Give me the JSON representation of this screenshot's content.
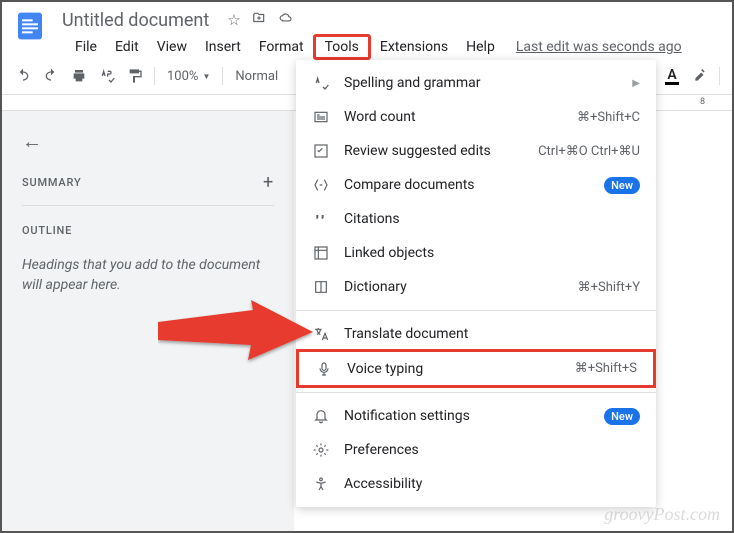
{
  "header": {
    "title": "Untitled document",
    "menus": [
      "File",
      "Edit",
      "View",
      "Insert",
      "Format",
      "Tools",
      "Extensions",
      "Help"
    ],
    "last_edit": "Last edit was seconds ago"
  },
  "toolbar": {
    "zoom": "100%",
    "style": "Normal"
  },
  "ruler": {
    "label8": "8"
  },
  "sidebar": {
    "summary_label": "SUMMARY",
    "outline_label": "OUTLINE",
    "outline_placeholder": "Headings that you add to the document will appear here."
  },
  "dropdown": {
    "items": [
      {
        "label": "Spelling and grammar",
        "hint": "",
        "arrow": true
      },
      {
        "label": "Word count",
        "hint": "⌘+Shift+C"
      },
      {
        "label": "Review suggested edits",
        "hint": "Ctrl+⌘O Ctrl+⌘U"
      },
      {
        "label": "Compare documents",
        "badge": "New"
      },
      {
        "label": "Citations"
      },
      {
        "label": "Linked objects"
      },
      {
        "label": "Dictionary",
        "hint": "⌘+Shift+Y"
      }
    ],
    "items2": [
      {
        "label": "Translate document"
      },
      {
        "label": "Voice typing",
        "hint": "⌘+Shift+S",
        "highlight": true
      }
    ],
    "items3": [
      {
        "label": "Notification settings",
        "badge": "New"
      },
      {
        "label": "Preferences"
      },
      {
        "label": "Accessibility"
      }
    ]
  },
  "watermark": "groovyPost.com"
}
